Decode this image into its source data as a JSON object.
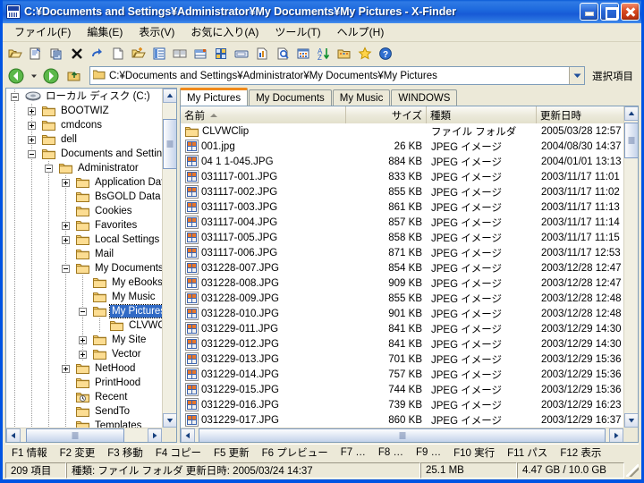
{
  "window": {
    "title": "C:¥Documents and Settings¥Administrator¥My Documents¥My Pictures - X-Finder",
    "minimize_label": "",
    "maximize_label": "",
    "close_label": ""
  },
  "menu": {
    "items": [
      {
        "label": "ファイル(F)"
      },
      {
        "label": "編集(E)"
      },
      {
        "label": "表示(V)"
      },
      {
        "label": "お気に入り(A)"
      },
      {
        "label": "ツール(T)"
      },
      {
        "label": "ヘルプ(H)"
      }
    ]
  },
  "toolbar": {
    "buttons": [
      {
        "icon": "open-folder-icon"
      },
      {
        "icon": "properties-icon"
      },
      {
        "icon": "copy-icon"
      },
      {
        "icon": "delete-x-icon"
      },
      {
        "icon": "redo-arrow-icon"
      },
      {
        "icon": "new-file-icon"
      },
      {
        "icon": "new-folder-icon"
      },
      {
        "icon": "list-view-icon"
      },
      {
        "icon": "thumbnail-view-icon"
      },
      {
        "icon": "details-view-icon"
      },
      {
        "icon": "tile-view-icon"
      },
      {
        "icon": "filmstrip-icon"
      },
      {
        "icon": "report-icon"
      },
      {
        "icon": "search-icon"
      },
      {
        "icon": "grid-icon"
      },
      {
        "icon": "sort-az-icon"
      },
      {
        "icon": "folder-options-icon"
      },
      {
        "icon": "favorites-star-icon"
      },
      {
        "icon": "help-icon"
      }
    ]
  },
  "addressbar": {
    "back_icon": "back-arrow-icon",
    "back_caret_icon": "chevron-down-icon",
    "forward_icon": "forward-arrow-icon",
    "up_icon": "up-folder-icon",
    "path": "C:¥Documents and Settings¥Administrator¥My Documents¥My Pictures",
    "dropdown_icon": "chevron-down-icon",
    "select_items_label": "選択項目"
  },
  "tree": {
    "nodes": [
      {
        "label": "ローカル ディスク (C:)",
        "depth": 0,
        "toggle": "minus",
        "icon": "drive-icon"
      },
      {
        "label": "BOOTWIZ",
        "depth": 1,
        "toggle": "plus",
        "icon": "folder-icon"
      },
      {
        "label": "cmdcons",
        "depth": 1,
        "toggle": "plus",
        "icon": "folder-icon"
      },
      {
        "label": "dell",
        "depth": 1,
        "toggle": "plus",
        "icon": "folder-icon"
      },
      {
        "label": "Documents and Settings",
        "depth": 1,
        "toggle": "minus",
        "icon": "folder-icon"
      },
      {
        "label": "Administrator",
        "depth": 2,
        "toggle": "minus",
        "icon": "folder-icon"
      },
      {
        "label": "Application Data",
        "depth": 3,
        "toggle": "plus",
        "icon": "folder-icon"
      },
      {
        "label": "BsGOLD Data",
        "depth": 3,
        "toggle": "none",
        "icon": "folder-icon"
      },
      {
        "label": "Cookies",
        "depth": 3,
        "toggle": "none",
        "icon": "folder-icon"
      },
      {
        "label": "Favorites",
        "depth": 3,
        "toggle": "plus",
        "icon": "folder-icon"
      },
      {
        "label": "Local Settings",
        "depth": 3,
        "toggle": "plus",
        "icon": "folder-icon"
      },
      {
        "label": "Mail",
        "depth": 3,
        "toggle": "none",
        "icon": "folder-icon"
      },
      {
        "label": "My Documents",
        "depth": 3,
        "toggle": "minus",
        "icon": "folder-icon"
      },
      {
        "label": "My eBooks",
        "depth": 4,
        "toggle": "none",
        "icon": "folder-icon"
      },
      {
        "label": "My Music",
        "depth": 4,
        "toggle": "none",
        "icon": "folder-icon"
      },
      {
        "label": "My Pictures",
        "depth": 4,
        "toggle": "minus",
        "icon": "folder-icon",
        "selected": true
      },
      {
        "label": "CLVWClip",
        "depth": 5,
        "toggle": "none",
        "icon": "folder-icon"
      },
      {
        "label": "My Site",
        "depth": 4,
        "toggle": "plus",
        "icon": "folder-icon"
      },
      {
        "label": "Vector",
        "depth": 4,
        "toggle": "plus",
        "icon": "folder-icon"
      },
      {
        "label": "NetHood",
        "depth": 3,
        "toggle": "plus",
        "icon": "folder-icon"
      },
      {
        "label": "PrintHood",
        "depth": 3,
        "toggle": "none",
        "icon": "folder-icon"
      },
      {
        "label": "Recent",
        "depth": 3,
        "toggle": "none",
        "icon": "recent-folder-icon"
      },
      {
        "label": "SendTo",
        "depth": 3,
        "toggle": "none",
        "icon": "folder-icon"
      },
      {
        "label": "Templates",
        "depth": 3,
        "toggle": "none",
        "icon": "folder-icon"
      }
    ]
  },
  "tabs": [
    {
      "label": "My Pictures",
      "active": true
    },
    {
      "label": "My Documents",
      "active": false
    },
    {
      "label": "My Music",
      "active": false
    },
    {
      "label": "WINDOWS",
      "active": false
    }
  ],
  "filelist": {
    "columns": [
      {
        "label": "名前",
        "align": "left",
        "sorted": true,
        "sort_dir": "asc"
      },
      {
        "label": "サイズ",
        "align": "right"
      },
      {
        "label": "種類",
        "align": "left"
      },
      {
        "label": "更新日時",
        "align": "left"
      }
    ],
    "rows": [
      {
        "name": "CLVWClip",
        "size": "",
        "type": "ファイル フォルダ",
        "date": "2005/03/28 12:57",
        "icon": "folder-icon"
      },
      {
        "name": "001.jpg",
        "size": "26 KB",
        "type": "JPEG イメージ",
        "date": "2004/08/30 14:37",
        "icon": "jpeg-icon"
      },
      {
        "name": "04 1 1-045.JPG",
        "size": "884 KB",
        "type": "JPEG イメージ",
        "date": "2004/01/01 13:13",
        "icon": "jpeg-icon"
      },
      {
        "name": "031117-001.JPG",
        "size": "833 KB",
        "type": "JPEG イメージ",
        "date": "2003/11/17 11:01",
        "icon": "jpeg-icon"
      },
      {
        "name": "031117-002.JPG",
        "size": "855 KB",
        "type": "JPEG イメージ",
        "date": "2003/11/17 11:02",
        "icon": "jpeg-icon"
      },
      {
        "name": "031117-003.JPG",
        "size": "861 KB",
        "type": "JPEG イメージ",
        "date": "2003/11/17 11:13",
        "icon": "jpeg-icon"
      },
      {
        "name": "031117-004.JPG",
        "size": "857 KB",
        "type": "JPEG イメージ",
        "date": "2003/11/17 11:14",
        "icon": "jpeg-icon"
      },
      {
        "name": "031117-005.JPG",
        "size": "858 KB",
        "type": "JPEG イメージ",
        "date": "2003/11/17 11:15",
        "icon": "jpeg-icon"
      },
      {
        "name": "031117-006.JPG",
        "size": "871 KB",
        "type": "JPEG イメージ",
        "date": "2003/11/17 12:53",
        "icon": "jpeg-icon"
      },
      {
        "name": "031228-007.JPG",
        "size": "854 KB",
        "type": "JPEG イメージ",
        "date": "2003/12/28 12:47",
        "icon": "jpeg-icon"
      },
      {
        "name": "031228-008.JPG",
        "size": "909 KB",
        "type": "JPEG イメージ",
        "date": "2003/12/28 12:47",
        "icon": "jpeg-icon"
      },
      {
        "name": "031228-009.JPG",
        "size": "855 KB",
        "type": "JPEG イメージ",
        "date": "2003/12/28 12:48",
        "icon": "jpeg-icon"
      },
      {
        "name": "031228-010.JPG",
        "size": "901 KB",
        "type": "JPEG イメージ",
        "date": "2003/12/28 12:48",
        "icon": "jpeg-icon"
      },
      {
        "name": "031229-011.JPG",
        "size": "841 KB",
        "type": "JPEG イメージ",
        "date": "2003/12/29 14:30",
        "icon": "jpeg-icon"
      },
      {
        "name": "031229-012.JPG",
        "size": "841 KB",
        "type": "JPEG イメージ",
        "date": "2003/12/29 14:30",
        "icon": "jpeg-icon"
      },
      {
        "name": "031229-013.JPG",
        "size": "701 KB",
        "type": "JPEG イメージ",
        "date": "2003/12/29 15:36",
        "icon": "jpeg-icon"
      },
      {
        "name": "031229-014.JPG",
        "size": "757 KB",
        "type": "JPEG イメージ",
        "date": "2003/12/29 15:36",
        "icon": "jpeg-icon"
      },
      {
        "name": "031229-015.JPG",
        "size": "744 KB",
        "type": "JPEG イメージ",
        "date": "2003/12/29 15:36",
        "icon": "jpeg-icon"
      },
      {
        "name": "031229-016.JPG",
        "size": "739 KB",
        "type": "JPEG イメージ",
        "date": "2003/12/29 16:23",
        "icon": "jpeg-icon"
      },
      {
        "name": "031229-017.JPG",
        "size": "860 KB",
        "type": "JPEG イメージ",
        "date": "2003/12/29 16:37",
        "icon": "jpeg-icon"
      }
    ]
  },
  "functionkeys": [
    {
      "label": "F1 情報"
    },
    {
      "label": "F2 変更"
    },
    {
      "label": "F3 移動"
    },
    {
      "label": "F4 コピー"
    },
    {
      "label": "F5 更新"
    },
    {
      "label": "F6 プレビュー"
    },
    {
      "label": "F7 …"
    },
    {
      "label": "F8 …"
    },
    {
      "label": "F9 …"
    },
    {
      "label": "F10 実行"
    },
    {
      "label": "F11 パス"
    },
    {
      "label": "F12 表示"
    }
  ],
  "statusbar": {
    "item_count": "209 項目",
    "details": "種類: ファイル フォルダ  更新日時: 2005/03/24 14:37",
    "selected_size": "25.1 MB",
    "disk_space": "4.47 GB / 10.0 GB"
  },
  "colors": {
    "titlebar_blue": "#1e6ade",
    "window_border": "#0054e3",
    "face": "#ece9d8",
    "selection": "#316ac5",
    "active_tab_accent": "#f08a1c"
  }
}
